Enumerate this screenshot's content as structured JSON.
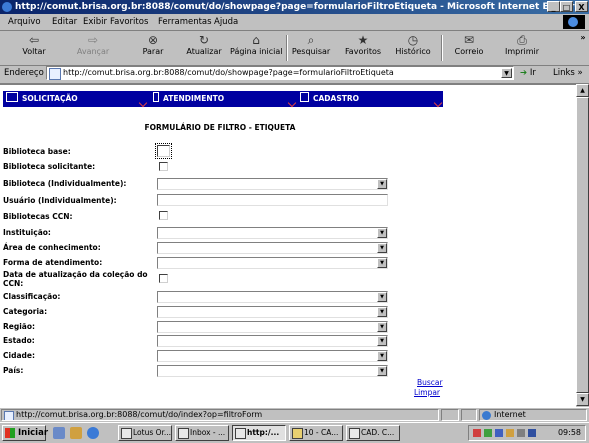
{
  "window": {
    "title": "http://comut.brisa.org.br:8088/comut/do/showpage?page=formularioFiltroEtiqueta - Microsoft Internet Explorer",
    "minimize": "_",
    "maximize": "□",
    "close": "X"
  },
  "menu": [
    "Arquivo",
    "Editar",
    "Exibir",
    "Favoritos",
    "Ferramentas",
    "Ajuda"
  ],
  "toolbar": {
    "back": "Voltar",
    "forward": "Avançar",
    "stop": "Parar",
    "refresh": "Atualizar",
    "home": "Página inicial",
    "search": "Pesquisar",
    "favorites": "Favoritos",
    "history": "Histórico",
    "mail": "Correio",
    "print": "Imprimir",
    "more": "»"
  },
  "address": {
    "label": "Endereço",
    "url": "http://comut.brisa.org.br:8088/comut/do/showpage?page=formularioFiltroEtiqueta",
    "go": "Ir",
    "links": "Links »"
  },
  "nav": {
    "tab1": "SOLICITAÇÃO",
    "tab2": "ATENDIMENTO",
    "tab3": "CADASTRO"
  },
  "form": {
    "title": "FORMULÁRIO DE FILTRO - ETIQUETA",
    "biblioteca_base": "Biblioteca base:",
    "biblioteca_solicitante": "Biblioteca solicitante:",
    "biblioteca_individual": "Biblioteca (Individualmente):",
    "usuario_individual": "Usuário (Individualmente):",
    "bibliotecas_ccn": "Bibliotecas CCN:",
    "instituicao": "Instituição:",
    "area_conhecimento": "Área de conhecimento:",
    "forma_atendimento": "Forma de atendimento:",
    "data_atualizacao": "Data de atualização da coleção do CCN:",
    "classificacao": "Classificação:",
    "categoria": "Categoria:",
    "regiao": "Região:",
    "estado": "Estado:",
    "cidade": "Cidade:",
    "pais": "País:",
    "buscar": "Buscar",
    "limpar": "Limpar"
  },
  "status": {
    "text": "http://comut.brisa.org.br:8088/comut/do/index?op=filtroForm",
    "zone": "Internet"
  },
  "taskbar": {
    "start": "Iniciar",
    "tasks": [
      "Lotus Or...",
      "Inbox - ...",
      "http:/...",
      "10 - CA...",
      "CAD. C..."
    ],
    "clock": "09:58"
  }
}
